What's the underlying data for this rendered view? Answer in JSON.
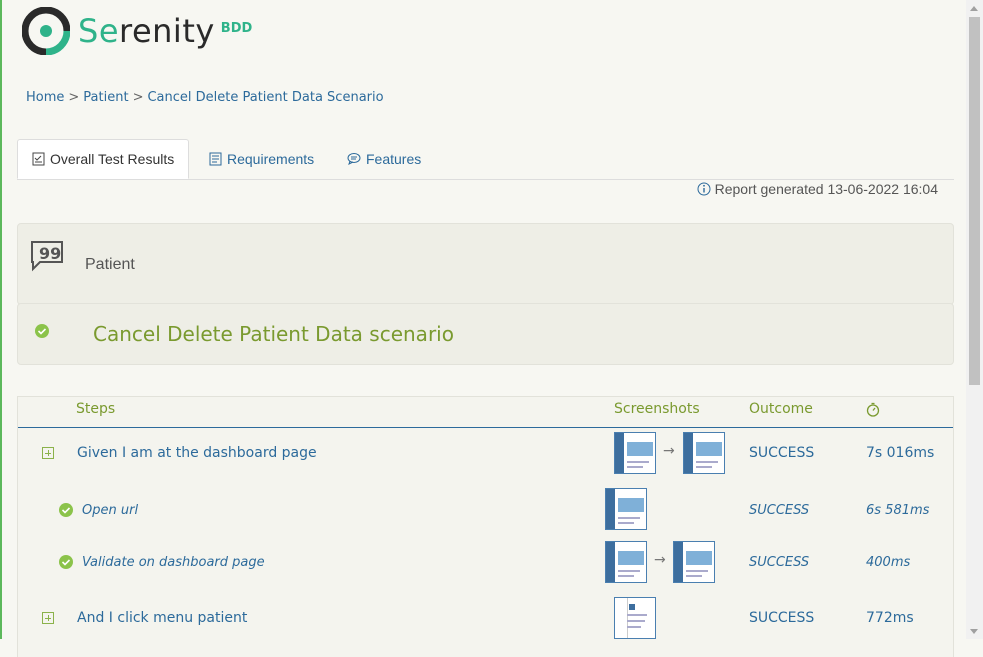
{
  "brand": {
    "name_part1": "Se",
    "name_part2": "renity",
    "suffix": "BDD",
    "accent": "#2fb38a"
  },
  "breadcrumb": {
    "home": "Home",
    "sep": ">",
    "feature": "Patient",
    "scenario": "Cancel Delete Patient Data Scenario"
  },
  "tabs": [
    {
      "label": "Overall Test Results",
      "icon": "checklist-icon",
      "active": true
    },
    {
      "label": "Requirements",
      "icon": "book-icon",
      "active": false
    },
    {
      "label": "Features",
      "icon": "comment-icon",
      "active": false
    }
  ],
  "report": {
    "text": "Report generated 13-06-2022 16:04"
  },
  "feature": {
    "name": "Patient"
  },
  "scenario": {
    "title": "Cancel Delete Patient Data scenario",
    "status_color": "#8bc34a"
  },
  "steps_table": {
    "headers": {
      "steps": "Steps",
      "screenshots": "Screenshots",
      "outcome": "Outcome",
      "duration_icon": "stopwatch-icon"
    },
    "rows": [
      {
        "text": "Given I am at the dashboard page",
        "outcome": "SUCCESS",
        "duration": "7s 016ms"
      },
      {
        "text": "Open url",
        "outcome": "SUCCESS",
        "duration": "6s 581ms"
      },
      {
        "text": "Validate on dashboard page",
        "outcome": "SUCCESS",
        "duration": "400ms"
      },
      {
        "text": "And I click menu patient",
        "outcome": "SUCCESS",
        "duration": "772ms"
      }
    ],
    "arrow": "→"
  }
}
